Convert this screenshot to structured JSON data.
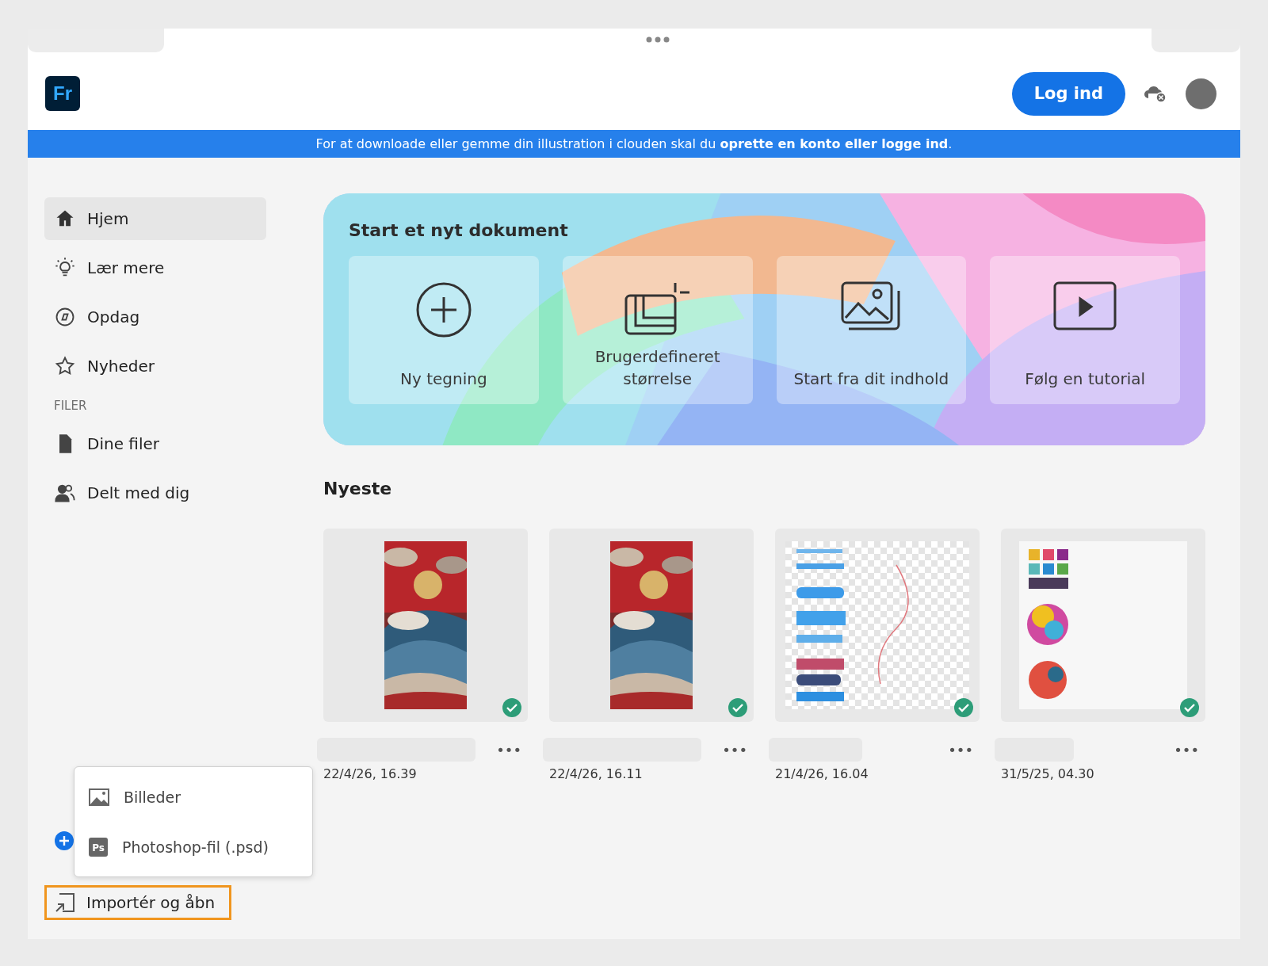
{
  "app": {
    "logo": "Fr"
  },
  "header": {
    "login_button": "Log ind"
  },
  "banner": {
    "text": "For at downloade eller gemme din illustration i clouden skal du **oprette en konto eller logge ind**."
  },
  "sidebar": {
    "items": [
      {
        "label": "Hjem",
        "selected": true
      },
      {
        "label": "Lær mere",
        "selected": false
      },
      {
        "label": "Opdag",
        "selected": false
      },
      {
        "label": "Nyheder",
        "selected": false
      }
    ],
    "section": "FILER",
    "file_items": [
      {
        "label": "Dine filer",
        "selected": false
      },
      {
        "label": "Delt med dig",
        "selected": false
      }
    ],
    "import": {
      "label": "Importér og åbn",
      "highlighted": true
    },
    "import_menu": [
      {
        "label": "Billeder"
      },
      {
        "label": "Photoshop-fil (.psd)",
        "badge": "Ps"
      }
    ]
  },
  "hero": {
    "title": "Start et nyt dokument",
    "actions": [
      {
        "label": "Ny tegning"
      },
      {
        "label": "Brugerdefineret størrelse"
      },
      {
        "label": "Start fra dit indhold"
      },
      {
        "label": "Følg en tutorial"
      }
    ]
  },
  "recent": {
    "title": "Nyeste",
    "items": [
      {
        "kind": "wave",
        "more": "•••",
        "date": "22/4/26, 16.39",
        "synced": true
      },
      {
        "kind": "wave",
        "more": "•••",
        "date": "22/4/26, 16.11",
        "synced": true
      },
      {
        "kind": "brushes",
        "more": "•••",
        "date": "21/4/26, 16.04",
        "synced": true
      },
      {
        "kind": "swatches",
        "more": "•••",
        "date": "31/5/25, 04.30",
        "synced": true
      }
    ]
  }
}
